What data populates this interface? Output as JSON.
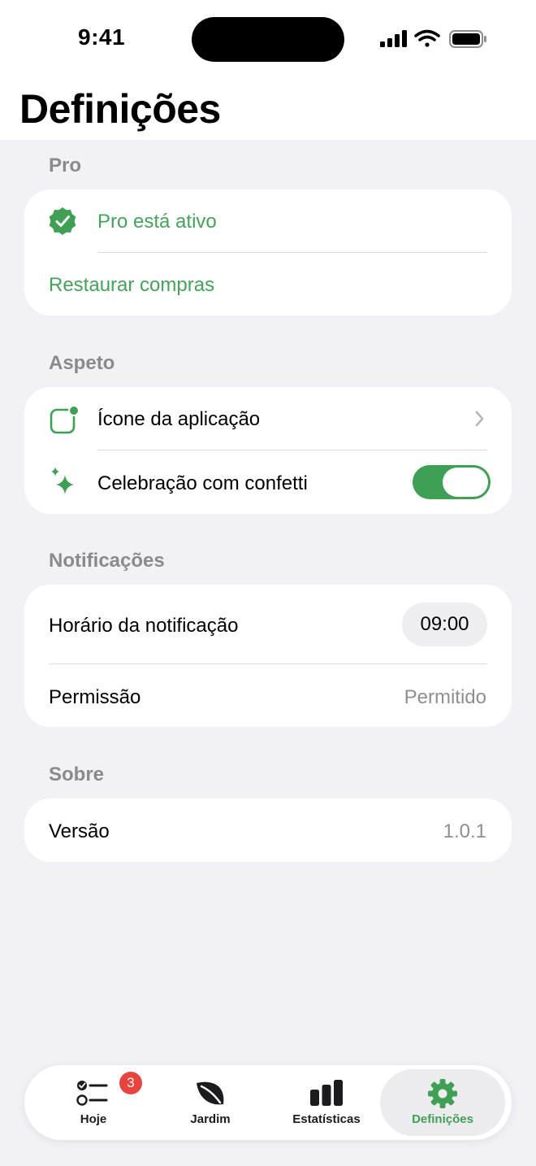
{
  "status_bar": {
    "time": "9:41"
  },
  "page": {
    "title": "Definições"
  },
  "sections": {
    "pro": {
      "label": "Pro",
      "status": "Pro está ativo",
      "restore": "Restaurar compras"
    },
    "appearance": {
      "label": "Aspeto",
      "app_icon": "Ícone da aplicação",
      "confetti": "Celebração com confetti",
      "confetti_enabled": true
    },
    "notifications": {
      "label": "Notificações",
      "time_label": "Horário da notificação",
      "time_value": "09:00",
      "permission_label": "Permissão",
      "permission_value": "Permitido"
    },
    "about": {
      "label": "Sobre",
      "version_label": "Versão",
      "version_value": "1.0.1"
    }
  },
  "tabbar": {
    "today": {
      "label": "Hoje",
      "badge": "3"
    },
    "garden": {
      "label": "Jardim"
    },
    "stats": {
      "label": "Estatísticas"
    },
    "settings": {
      "label": "Definições"
    }
  },
  "colors": {
    "accent": "#3f9f55",
    "background": "#f2f2f6",
    "badge": "#e9433f"
  }
}
